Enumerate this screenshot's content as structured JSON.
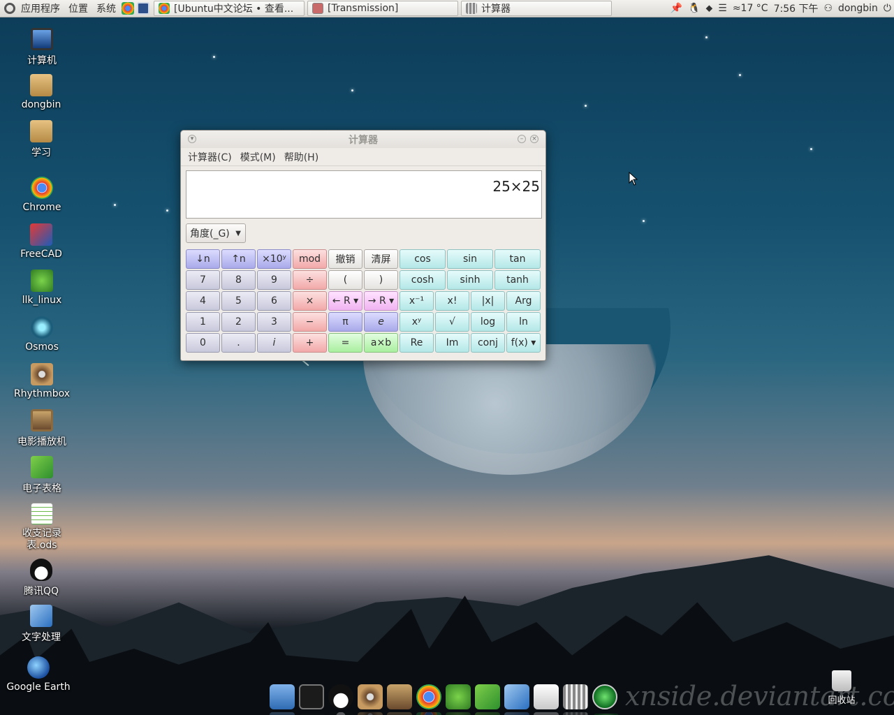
{
  "top_panel": {
    "menus": [
      "应用程序",
      "位置",
      "系统"
    ],
    "tasks": [
      {
        "label": "[Ubuntu中文论坛 • 查看..."
      },
      {
        "label": "[Transmission]"
      },
      {
        "label": "计算器"
      }
    ],
    "weather": "≈17 °C",
    "time": "7:56 下午",
    "user": "dongbin"
  },
  "desktop_icons": [
    {
      "label": "计算机"
    },
    {
      "label": "dongbin"
    },
    {
      "label": "学习"
    },
    {
      "label": "Chrome"
    },
    {
      "label": "FreeCAD"
    },
    {
      "label": "llk_linux"
    },
    {
      "label": "Osmos"
    },
    {
      "label": "Rhythmbox"
    },
    {
      "label": "电影播放机"
    },
    {
      "label": "电子表格"
    },
    {
      "label": "收支记录表.ods"
    },
    {
      "label": "腾讯QQ"
    },
    {
      "label": "文字处理"
    },
    {
      "label": "Google Earth"
    }
  ],
  "calculator": {
    "title": "计算器",
    "menus": [
      "计算器(C)",
      "模式(M)",
      "帮助(H)"
    ],
    "display": "25×25",
    "angle_unit": "角度(_G)",
    "rows": [
      [
        "↓n",
        "↑n",
        "×10ʸ",
        "mod",
        "撤销",
        "清屏",
        "cos",
        "sin",
        "tan"
      ],
      [
        "7",
        "8",
        "9",
        "÷",
        "(",
        ")",
        "cosh",
        "sinh",
        "tanh"
      ],
      [
        "4",
        "5",
        "6",
        "×",
        "← R ▾",
        "→ R ▾",
        "x⁻¹",
        "x!",
        "|x|",
        "Arg"
      ],
      [
        "1",
        "2",
        "3",
        "−",
        "π",
        "e",
        "xʸ",
        "√",
        "log",
        "ln"
      ],
      [
        "0",
        ".",
        "i",
        "+",
        "=",
        "a×b",
        "Re",
        "Im",
        "conj",
        "f(x) ▾"
      ]
    ]
  },
  "trash_label": "回收站",
  "watermark": "xnside.deviantart.com"
}
